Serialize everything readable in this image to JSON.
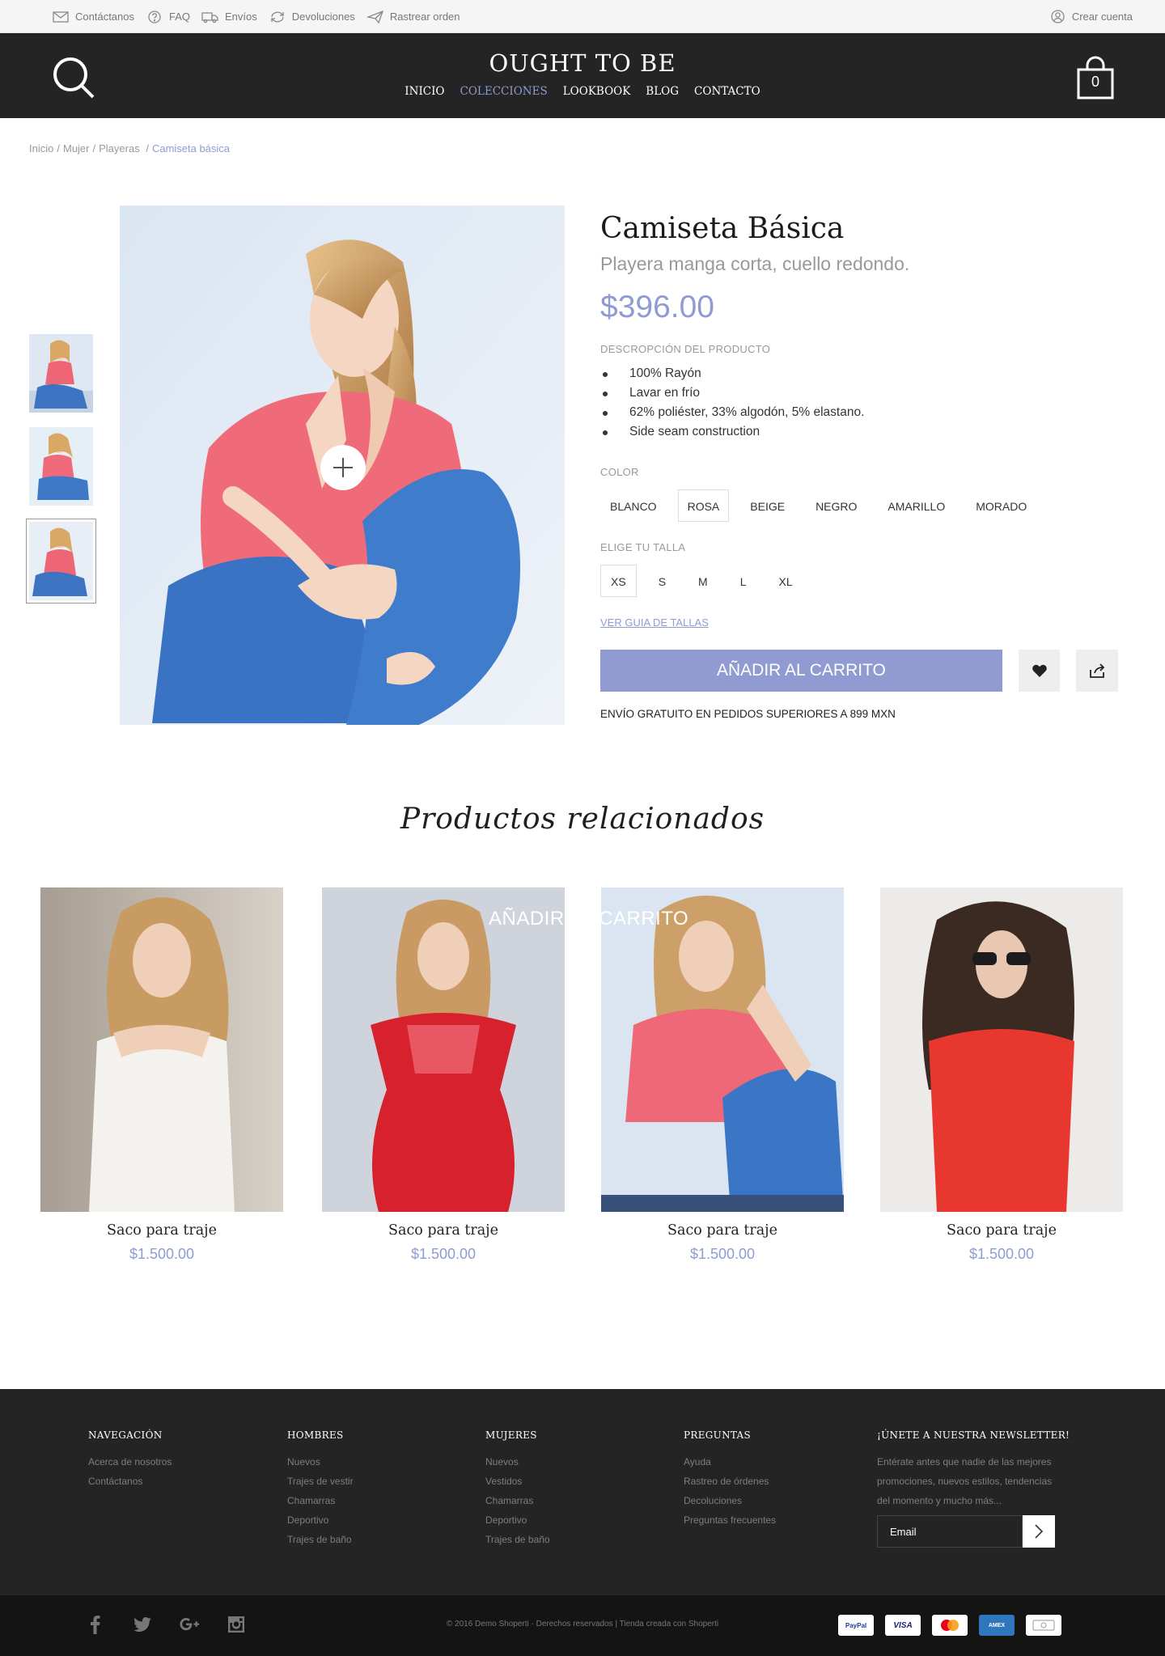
{
  "topbar": {
    "links": [
      {
        "label": "Contáctanos",
        "icon": "mail-icon"
      },
      {
        "label": "FAQ",
        "icon": "help-icon"
      },
      {
        "label": "Envíos",
        "icon": "truck-icon"
      },
      {
        "label": "Devoluciones",
        "icon": "refresh-icon"
      },
      {
        "label": "Rastrear orden",
        "icon": "paper-plane-icon"
      }
    ],
    "account_label": "Crear cuenta"
  },
  "header": {
    "logo": "OUGHT TO BE",
    "nav": [
      "INICIO",
      "COLECCIONES",
      "LOOKBOOK",
      "BLOG",
      "CONTACTO"
    ],
    "active_nav": "COLECCIONES",
    "cart_count": "0"
  },
  "breadcrumb": [
    "Inicio",
    "Mujer",
    "Playeras",
    "Camiseta básica"
  ],
  "product": {
    "title": "Camiseta Básica",
    "subtitle": "Playera manga corta, cuello redondo.",
    "price": "$396.00",
    "description_label": "DESCROPCIÓN DEL PRODUCTO",
    "features": [
      "100% Rayón",
      "Lavar en frío",
      "62% poliéster, 33% algodón, 5% elastano.",
      "Side seam construction"
    ],
    "color_label": "COLOR",
    "colors": [
      "BLANCO",
      "ROSA",
      "BEIGE",
      "NEGRO",
      "AMARILLO",
      "MORADO"
    ],
    "selected_color": "ROSA",
    "size_label": "ELIGE TU TALLA",
    "sizes": [
      "XS",
      "S",
      "M",
      "L",
      "XL"
    ],
    "selected_size": "XS",
    "size_guide_label": "VER GUIA DE TALLAS",
    "add_to_cart_label": "AÑADIR AL CARRITO",
    "shipping_note": "ENVÍO GRATUITO EN PEDIDOS SUPERIORES A 899 MXN",
    "thumbnails_count": 3,
    "active_thumbnail": 3
  },
  "related": {
    "title": "Productos relacionados",
    "hover_add_label": "AÑADIR AL CARRITO",
    "items": [
      {
        "name": "Saco para traje",
        "price": "$1.500.00"
      },
      {
        "name": "Saco para traje",
        "price": "$1.500.00"
      },
      {
        "name": "Saco para traje",
        "price": "$1.500.00"
      },
      {
        "name": "Saco para traje",
        "price": "$1.500.00"
      }
    ]
  },
  "footer": {
    "columns": [
      {
        "title": "NAVEGACIÓN",
        "links": [
          "Acerca de nosotros",
          "Contáctanos"
        ]
      },
      {
        "title": "HOMBRES",
        "links": [
          "Nuevos",
          "Trajes de vestir",
          "Chamarras",
          "Deportivo",
          "Trajes de baño"
        ]
      },
      {
        "title": "MUJERES",
        "links": [
          "Nuevos",
          "Vestidos",
          "Chamarras",
          "Deportivo",
          "Trajes de baño"
        ]
      },
      {
        "title": "PREGUNTAS",
        "links": [
          "Ayuda",
          "Rastreo de órdenes",
          "Decoluciones",
          "Preguntas frecuentes"
        ]
      }
    ],
    "newsletter": {
      "title": "¡ÚNETE A NUESTRA NEWSLETTER!",
      "text": "Entérate antes que nadie de las mejores promociones, nuevos estilos, tendencias del momento y mucho más...",
      "placeholder": "Email"
    },
    "social": [
      "facebook-icon",
      "twitter-icon",
      "google-plus-icon",
      "instagram-icon"
    ],
    "copyright": "© 2016 Demo Shoperti · Derechos reservados | Tienda creada con Shoperti",
    "payments": [
      "PayPal",
      "VISA",
      "mastercard",
      "AMEX",
      "cash"
    ]
  },
  "colors": {
    "accent": "#8f9bd1",
    "header_bg": "#242424",
    "footer_bottom_bg": "#141414"
  }
}
